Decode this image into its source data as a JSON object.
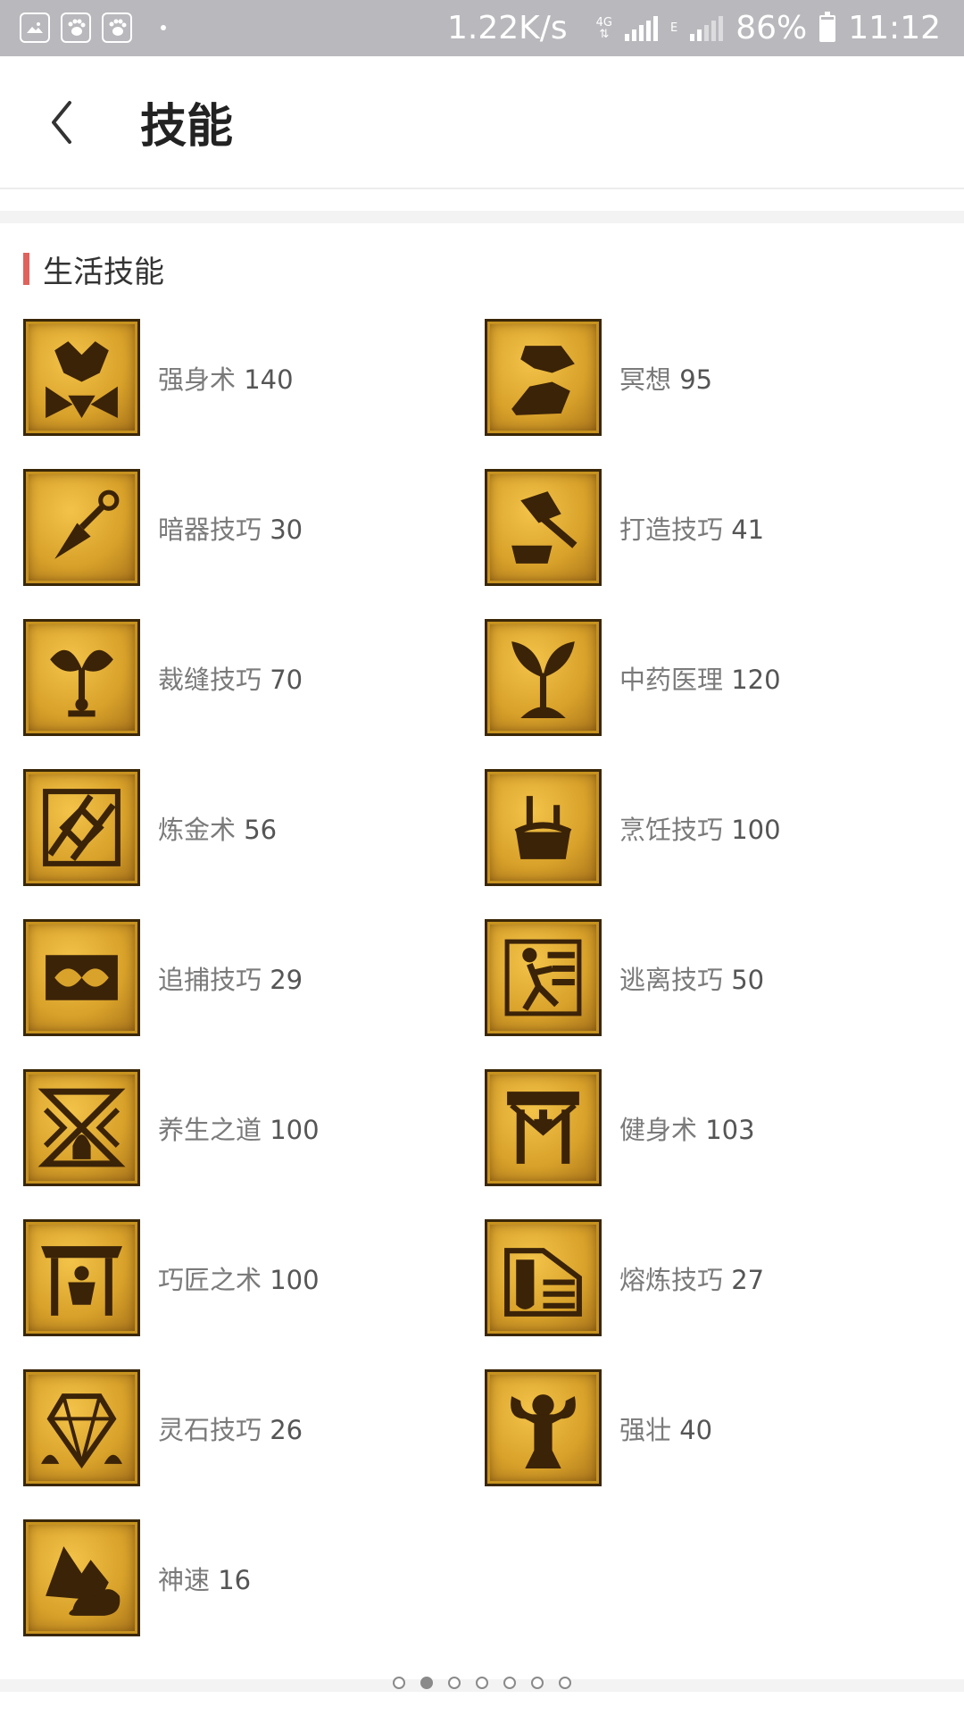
{
  "status_bar": {
    "net_speed": "1.22K/s",
    "network_type": "4G",
    "secondary_network": "E",
    "battery": "86%",
    "battery_level": 0.86,
    "time": "11:12",
    "left_icons": [
      "gallery-icon",
      "baidu-paw-icon",
      "baidu-paw-icon"
    ]
  },
  "header": {
    "title": "技能",
    "back_icon": "chevron-left-icon"
  },
  "section": {
    "title": "生活技能",
    "accent_color": "#e0625c"
  },
  "skills": [
    {
      "name": "强身术",
      "level": "140",
      "icon": "muscle-emblem-icon"
    },
    {
      "name": "冥想",
      "level": "95",
      "icon": "meditation-icon"
    },
    {
      "name": "暗器技巧",
      "level": "30",
      "icon": "dart-icon"
    },
    {
      "name": "打造技巧",
      "level": "41",
      "icon": "hammer-anvil-icon"
    },
    {
      "name": "裁缝技巧",
      "level": "70",
      "icon": "scissors-icon"
    },
    {
      "name": "中药医理",
      "level": "120",
      "icon": "herb-sprout-icon"
    },
    {
      "name": "炼金术",
      "level": "56",
      "icon": "alchemy-icon"
    },
    {
      "name": "烹饪技巧",
      "level": "100",
      "icon": "cooking-pot-icon"
    },
    {
      "name": "追捕技巧",
      "level": "29",
      "icon": "chain-icon"
    },
    {
      "name": "逃离技巧",
      "level": "50",
      "icon": "running-man-icon"
    },
    {
      "name": "养生之道",
      "level": "100",
      "icon": "wellness-emblem-icon"
    },
    {
      "name": "健身术",
      "level": "103",
      "icon": "fitness-emblem-icon"
    },
    {
      "name": "巧匠之术",
      "level": "100",
      "icon": "workshop-icon"
    },
    {
      "name": "熔炼技巧",
      "level": "27",
      "icon": "smelting-icon"
    },
    {
      "name": "灵石技巧",
      "level": "26",
      "icon": "gemstone-icon"
    },
    {
      "name": "强壮",
      "level": "40",
      "icon": "strongman-icon"
    },
    {
      "name": "神速",
      "level": "16",
      "icon": "cloud-speed-icon"
    }
  ],
  "pager": {
    "total": 7,
    "active": 2
  }
}
